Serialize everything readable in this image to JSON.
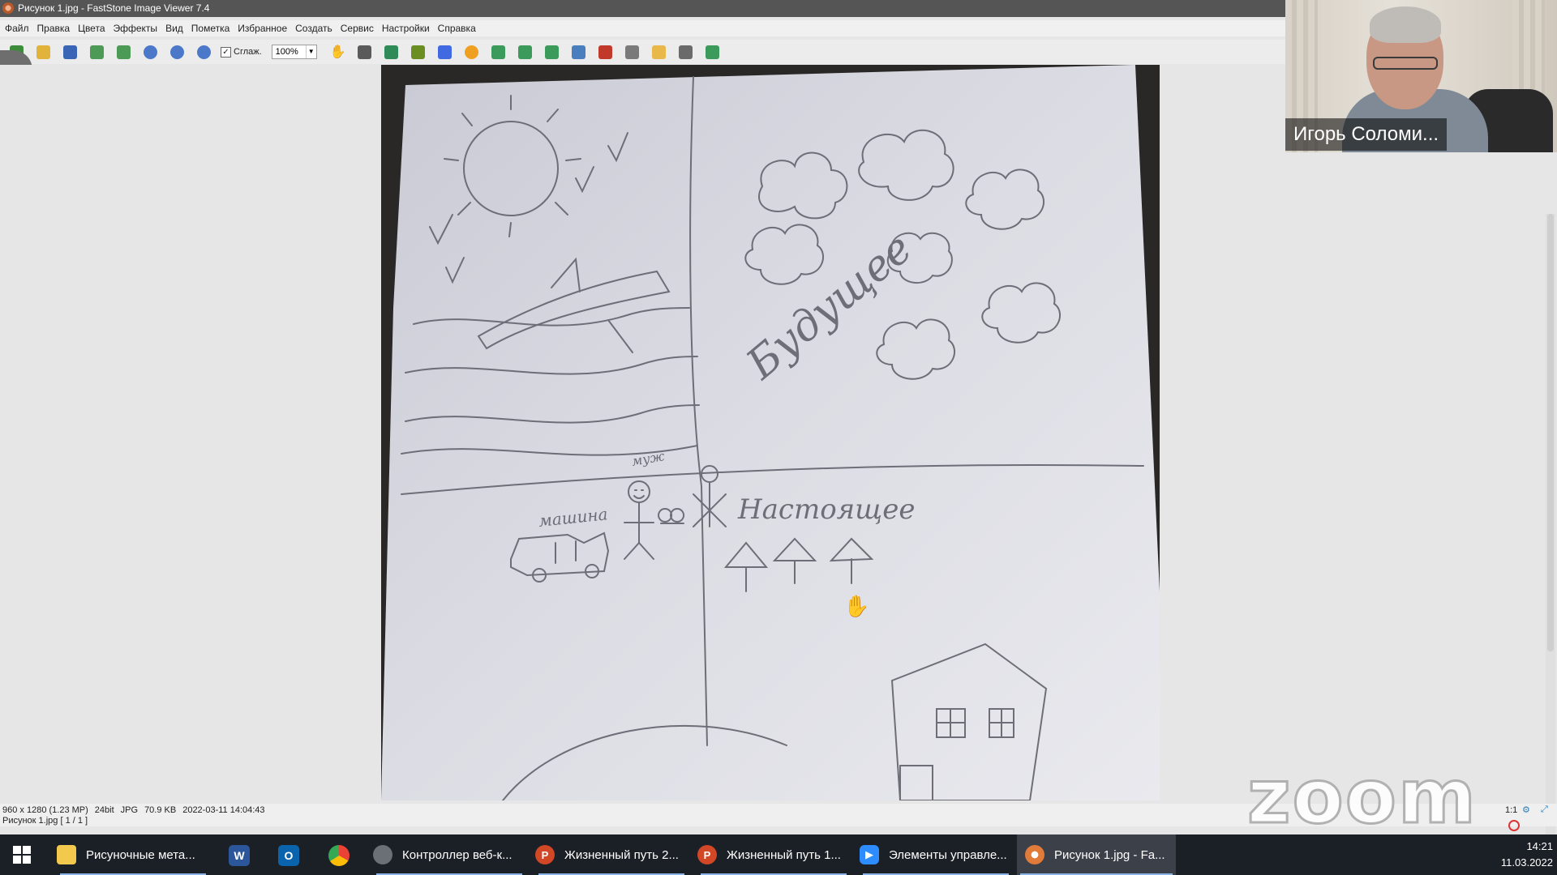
{
  "window": {
    "title": "Рисунок 1.jpg  -  FastStone Image Viewer 7.4"
  },
  "menu": [
    "Файл",
    "Правка",
    "Цвета",
    "Эффекты",
    "Вид",
    "Пометка",
    "Избранное",
    "Создать",
    "Сервис",
    "Настройки",
    "Справка"
  ],
  "toolbar": {
    "smooth_label": "Сглаж.",
    "smooth_checked": true,
    "zoom_value": "100%",
    "icons": [
      "open-icon",
      "browse-icon",
      "save-icon",
      "prev-image-icon",
      "next-image-icon",
      "zoom-in-icon",
      "zoom-out-icon",
      "actual-size-icon",
      "hand-tool-icon",
      "fit-icon",
      "crop-icon",
      "resize-icon",
      "rotate-icon",
      "color-icon",
      "adjust-icon",
      "flip-icon",
      "effects-icon",
      "compare-icon",
      "slideshow-icon",
      "draw-icon",
      "folder-icon",
      "print-icon",
      "email-icon"
    ]
  },
  "drawing": {
    "words": {
      "future": "Будущее",
      "present": "Настоящее",
      "car": "машина",
      "person": "муж"
    }
  },
  "status": {
    "dimensions": "960 x 1280 (1.23 MP)",
    "bit_depth": "24bit",
    "format": "JPG",
    "file_size": "70.9 KB",
    "datetime": "2022-03-11 14:04:43",
    "file_index": "Рисунок 1.jpg [ 1 / 1 ]",
    "ratio": "1:1"
  },
  "zoom": {
    "participant_name": "Игорь Соломи...",
    "logo_text": "zoom"
  },
  "taskbar": {
    "items": [
      {
        "label": "Рисуночные мета...",
        "icon": "file-explorer-icon",
        "color": "#f2c94c"
      },
      {
        "label": "Контроллер веб-к...",
        "icon": "webcam-controller-icon",
        "color": "#6b6f76"
      },
      {
        "label": "Жизненный путь 2...",
        "icon": "powerpoint-icon",
        "color": "#d24726"
      },
      {
        "label": "Жизненный путь 1...",
        "icon": "powerpoint-icon",
        "color": "#d24726"
      },
      {
        "label": "Элементы управле...",
        "icon": "zoom-app-icon",
        "color": "#2d8cff"
      },
      {
        "label": "Рисунок 1.jpg - Fa...",
        "icon": "faststone-icon",
        "color": "#e07b39"
      }
    ],
    "pinned": [
      {
        "icon": "word-icon",
        "letter": "W",
        "color": "#2b579a"
      },
      {
        "icon": "outlook-icon",
        "letter": "O",
        "color": "#0a64ad"
      },
      {
        "icon": "chrome-icon",
        "letter": "",
        "color": "#34a853"
      }
    ],
    "time": "14:21",
    "date": "11.03.2022"
  }
}
